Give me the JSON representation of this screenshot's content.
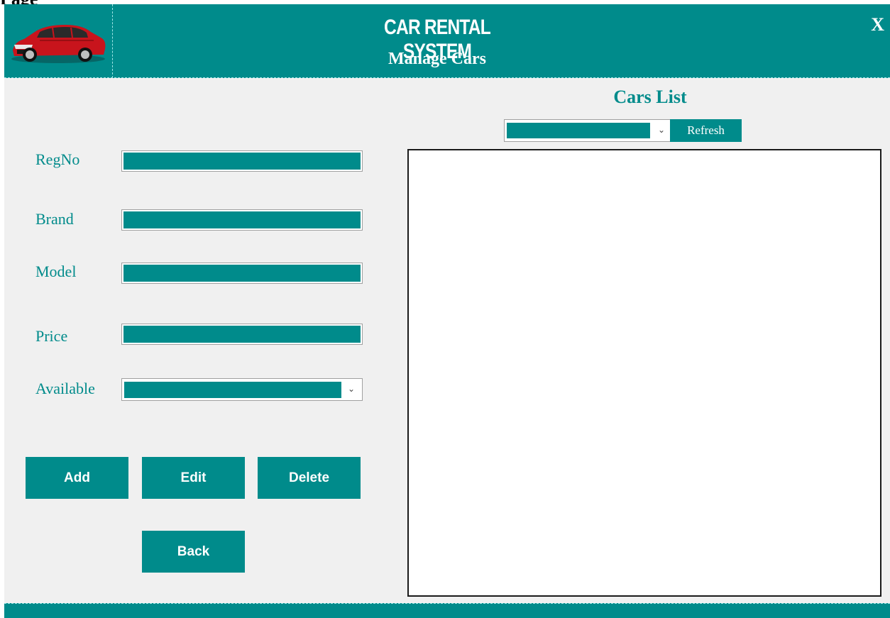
{
  "header": {
    "app_title": "CAR RENTAL SYSTEM",
    "page_title": "Manage Cars",
    "close_label": "X"
  },
  "form": {
    "regno_label": "RegNo",
    "regno_value": "",
    "brand_label": "Brand",
    "brand_value": "",
    "model_label": "Model",
    "model_value": "",
    "price_label": "Price",
    "price_value": "",
    "available_label": "Available",
    "available_value": ""
  },
  "buttons": {
    "add": "Add",
    "edit": "Edit",
    "delete": "Delete",
    "back": "Back"
  },
  "list": {
    "title": "Cars List",
    "filter_value": "",
    "refresh_label": "Refresh",
    "rows": []
  },
  "colors": {
    "accent": "#008b8b",
    "background": "#f0f0f0",
    "list_background": "#ffffff"
  },
  "icons": {
    "logo": "car-logo-image",
    "dropdown": "chevron-down-icon"
  }
}
